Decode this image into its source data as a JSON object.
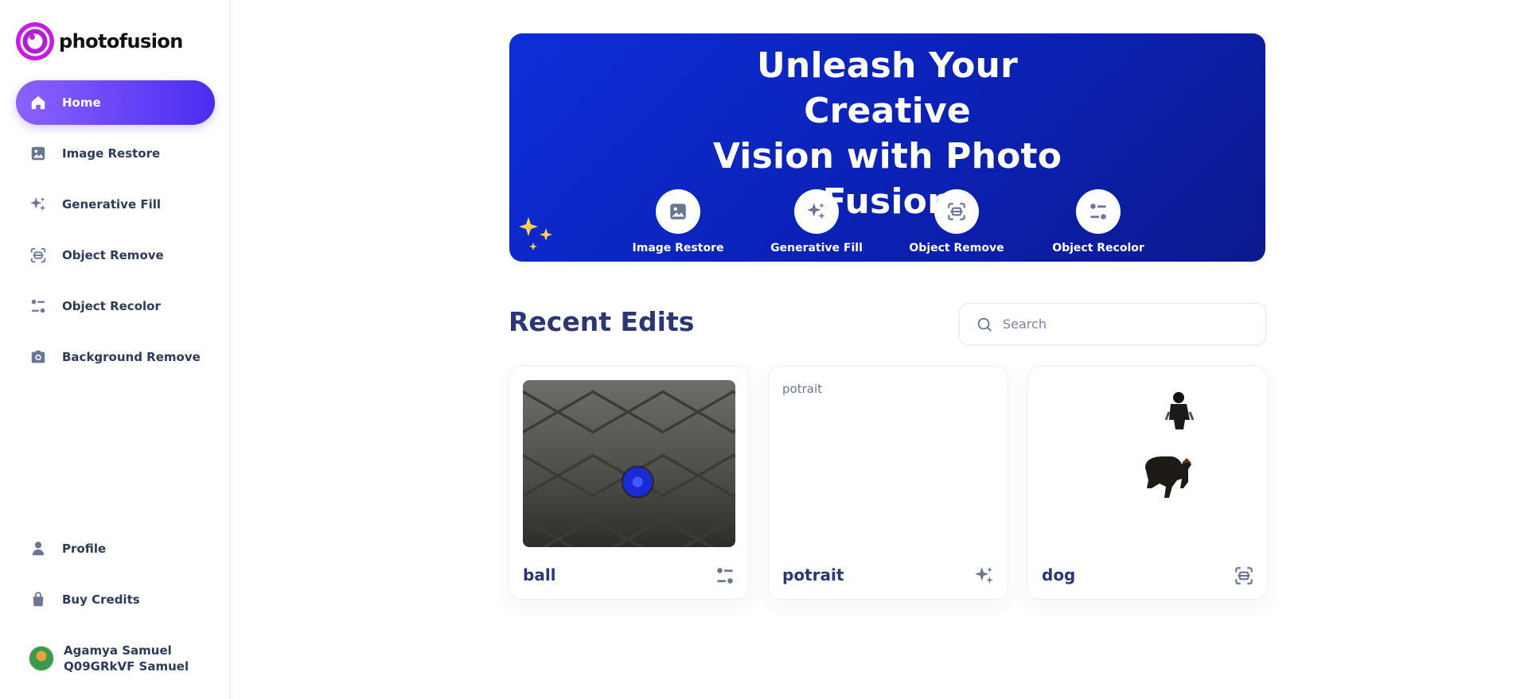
{
  "brand": {
    "name": "photofusion"
  },
  "sidebar": {
    "items": [
      {
        "label": "Home",
        "icon": "home-icon",
        "active": true
      },
      {
        "label": "Image Restore",
        "icon": "image-icon",
        "active": false
      },
      {
        "label": "Generative Fill",
        "icon": "sparkles-icon",
        "active": false
      },
      {
        "label": "Object Remove",
        "icon": "object-remove-icon",
        "active": false
      },
      {
        "label": "Object Recolor",
        "icon": "recolor-icon",
        "active": false
      },
      {
        "label": "Background Remove",
        "icon": "camera-icon",
        "active": false
      }
    ],
    "bottom_items": [
      {
        "label": "Profile",
        "icon": "user-icon"
      },
      {
        "label": "Buy Credits",
        "icon": "bag-icon"
      }
    ],
    "user": {
      "name_line1": "Agamya Samuel",
      "name_line2": "Q09GRkVF Samuel"
    }
  },
  "hero": {
    "title_line1": "Unleash Your Creative",
    "title_line2": "Vision with Photo",
    "title_line3": "Fusion",
    "tools": [
      {
        "label": "Image Restore",
        "icon": "image-icon"
      },
      {
        "label": "Generative Fill",
        "icon": "sparkles-icon"
      },
      {
        "label": "Object Remove",
        "icon": "object-remove-icon"
      },
      {
        "label": "Object Recolor",
        "icon": "recolor-icon"
      }
    ]
  },
  "recent": {
    "title": "Recent Edits",
    "search_placeholder": "Search",
    "cards": [
      {
        "title": "ball",
        "icon": "recolor-icon"
      },
      {
        "title": "potrait",
        "alt": "potrait",
        "icon": "sparkles-icon"
      },
      {
        "title": "dog",
        "icon": "object-remove-icon"
      }
    ]
  },
  "colors": {
    "accent": "#4b2cf0",
    "hero": "#0b22b8",
    "text": "#2b3674",
    "icon_muted": "#6b7694"
  }
}
